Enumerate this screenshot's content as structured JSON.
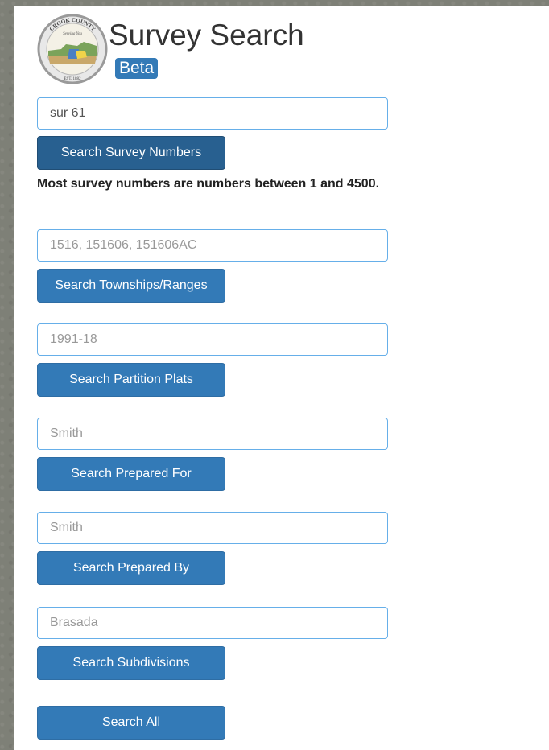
{
  "header": {
    "logo_text_top": "CROOK COUNTY",
    "logo_text_mid": "Serving You",
    "logo_text_bottom": "EST. 1882",
    "title": "Survey Search",
    "badge": "Beta"
  },
  "survey_numbers": {
    "value": "sur 61",
    "button": "Search Survey Numbers",
    "help": "Most survey numbers are numbers between 1 and 4500."
  },
  "townships": {
    "placeholder": "1516, 151606, 151606AC",
    "button": "Search Townships/Ranges"
  },
  "partition_plats": {
    "placeholder": "1991-18",
    "button": "Search Partition Plats"
  },
  "prepared_for": {
    "placeholder": "Smith",
    "button": "Search Prepared For"
  },
  "prepared_by": {
    "placeholder": "Smith",
    "button": "Search Prepared By"
  },
  "subdivisions": {
    "placeholder": "Brasada",
    "button": "Search Subdivisions"
  },
  "search_all": {
    "button": "Search All"
  },
  "colors": {
    "primary": "#337ab7",
    "primary_active": "#286090",
    "input_focus_border": "#66afe9",
    "background": "#7e8077"
  }
}
